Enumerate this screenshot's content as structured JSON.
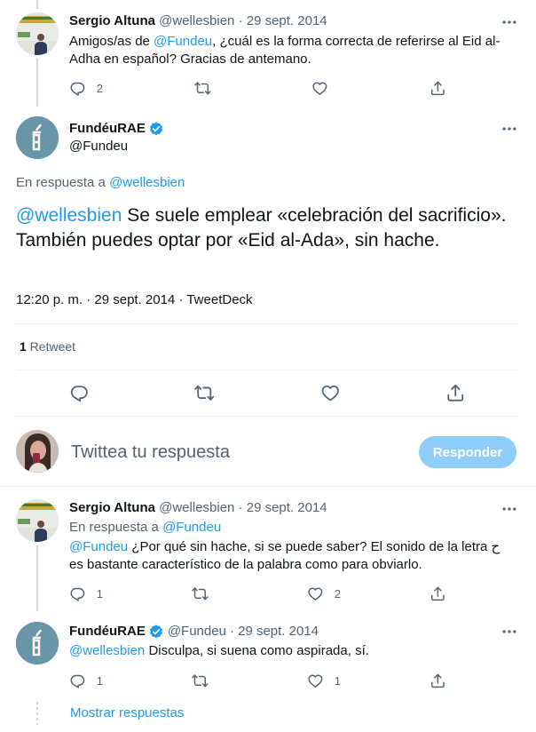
{
  "tweet1": {
    "name": "Sergio Altuna",
    "handle": "@wellesbien",
    "date": "· 29 sept. 2014",
    "text_prefix": "Amigos/as de ",
    "mention": "@Fundeu",
    "text_suffix": ", ¿cuál es la forma correcta de referirse al Eid al-Adha en español? Gracias de antemano.",
    "replies": "2"
  },
  "main": {
    "name": "FundéuRAE",
    "handle": "@Fundeu",
    "reply_to_label": "En respuesta a ",
    "reply_to_handle": "@wellesbien",
    "mention": "@wellesbien",
    "text": " Se suele emplear «celebración del sacrificio». También puedes optar por «Eid al-Ada», sin hache.",
    "timestamp": "12:20 p. m. · 29 sept. 2014 · TweetDeck",
    "retweet_count": "1",
    "retweet_label": " Retweet"
  },
  "composer": {
    "placeholder": "Twittea tu respuesta",
    "reply_button": "Responder"
  },
  "reply1": {
    "name": "Sergio Altuna",
    "handle": "@wellesbien",
    "date": "· 29 sept. 2014",
    "reply_to_label": "En respuesta a ",
    "reply_to_handle": "@Fundeu",
    "mention": "@Fundeu",
    "text": " ¿Por qué sin hache, si se puede saber? El sonido de la letra ح es bastante característico de la palabra como para obviarlo.",
    "replies": "1",
    "likes": "2"
  },
  "reply2": {
    "name": "FundéuRAE",
    "handle": "@Fundeu",
    "date": "· 29 sept. 2014",
    "mention": "@wellesbien",
    "text": " Disculpa, si suena como aspirada, sí.",
    "replies": "1",
    "likes": "1"
  },
  "show_replies": "Mostrar respuestas",
  "colors": {
    "accent": "#1d9bf0",
    "reply_button_disabled": "#8ecdf8",
    "muted": "#536471"
  },
  "icons": [
    "more-icon",
    "reply-icon",
    "retweet-icon",
    "like-icon",
    "share-icon",
    "verified-icon"
  ]
}
